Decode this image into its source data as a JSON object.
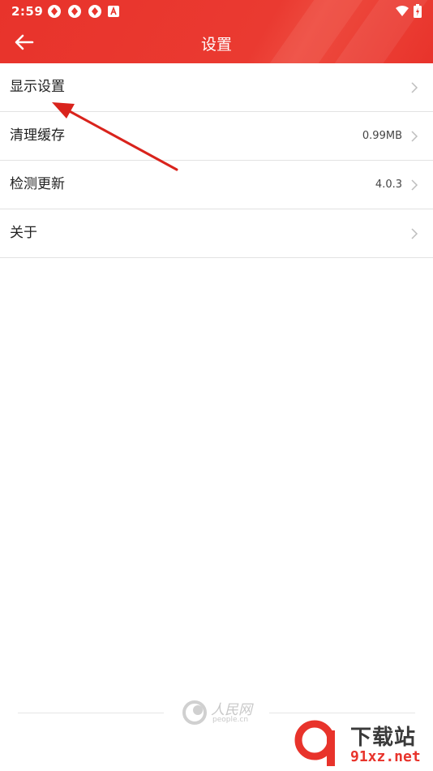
{
  "status_bar": {
    "time": "2:59"
  },
  "header": {
    "title": "设置"
  },
  "settings": [
    {
      "label": "显示设置",
      "value": ""
    },
    {
      "label": "清理缓存",
      "value": "0.99MB"
    },
    {
      "label": "检测更新",
      "value": "4.0.3"
    },
    {
      "label": "关于",
      "value": ""
    }
  ],
  "footer": {
    "logo_text": "人民网",
    "logo_sub": "people.cn"
  },
  "watermark": {
    "title": "下载站",
    "site": "91xz.net"
  },
  "colors": {
    "accent": "#e8332b",
    "arrow": "#d9231c"
  }
}
